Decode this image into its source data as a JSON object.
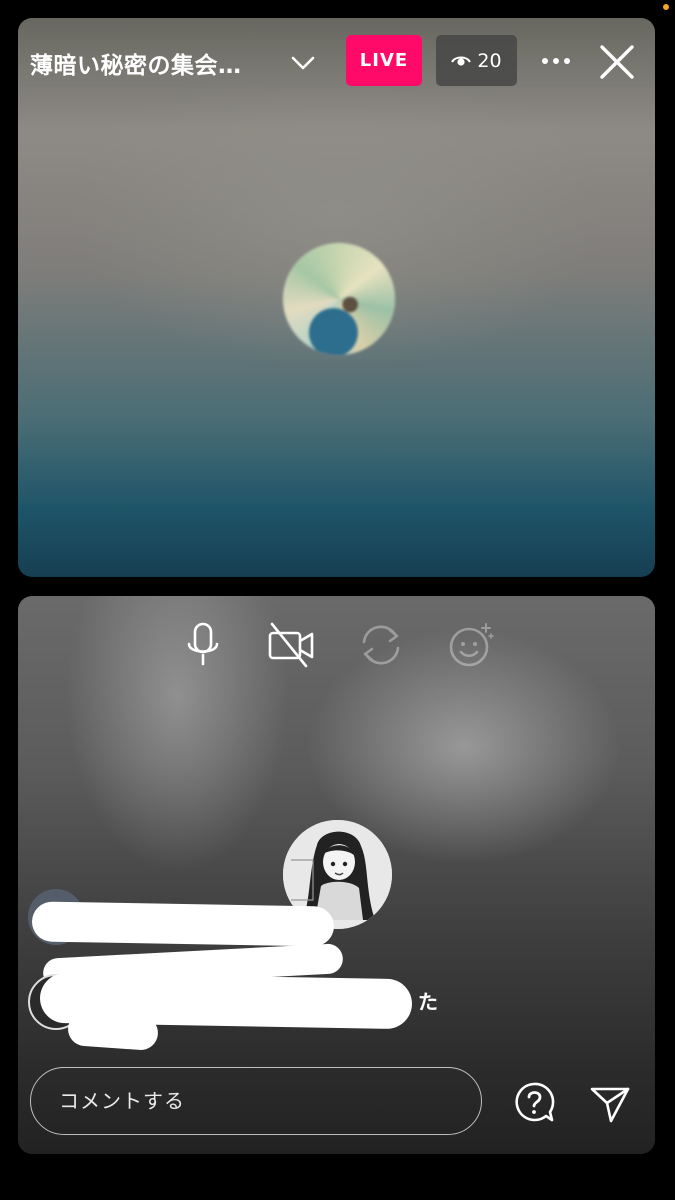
{
  "stream": {
    "title": "薄暗い秘密の集会…",
    "live_label": "LIVE",
    "viewer_count": "20"
  },
  "comments": {
    "visible_suffix": "た"
  },
  "input": {
    "placeholder": "コメントする"
  },
  "icons": {
    "dropdown": "chevron-down-icon",
    "viewers": "eye-icon",
    "more": "more-horizontal-icon",
    "close": "close-icon",
    "mic": "microphone-icon",
    "camera_off": "video-off-icon",
    "flip": "camera-flip-icon",
    "effects": "face-effects-icon",
    "question": "question-icon",
    "send": "send-icon"
  },
  "colors": {
    "live_badge": "#ff0a69",
    "viewer_badge": "#464646"
  }
}
